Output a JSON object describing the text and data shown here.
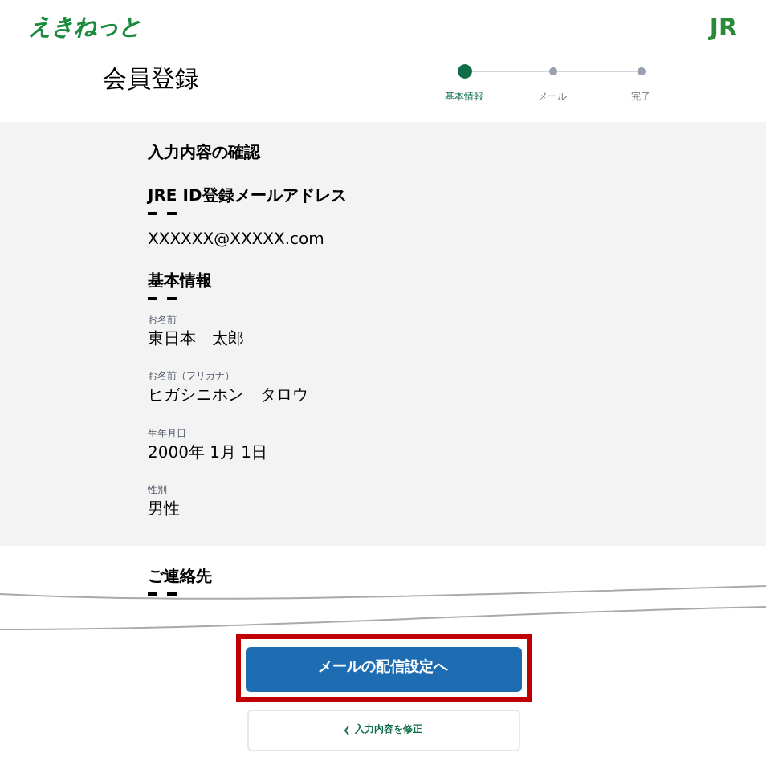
{
  "header": {
    "logo": "えきねっと",
    "jr_logo": "JR"
  },
  "page_title": "会員登録",
  "steps": [
    {
      "label": "基本情報",
      "selected": true
    },
    {
      "label": "メール",
      "selected": false
    },
    {
      "label": "完了",
      "selected": false
    }
  ],
  "confirm": {
    "title": "入力内容の確認",
    "sections": [
      {
        "heading": "JRE ID登録メールアドレス",
        "fields": [
          {
            "value": "XXXXXX@XXXXX.com"
          }
        ]
      },
      {
        "heading": "基本情報",
        "fields": [
          {
            "label": "お名前",
            "value": "東日本　太郎"
          },
          {
            "label": "お名前（フリガナ）",
            "value": "ヒガシニホン　タロウ"
          },
          {
            "label": "生年月日",
            "value": "2000年 1月 1日"
          },
          {
            "label": "性別",
            "value": "男性"
          }
        ]
      }
    ]
  },
  "next_section": {
    "heading": "ご連絡先"
  },
  "buttons": {
    "primary": "メールの配信設定へ",
    "back": "入力内容を修正",
    "highlighted": true
  }
}
